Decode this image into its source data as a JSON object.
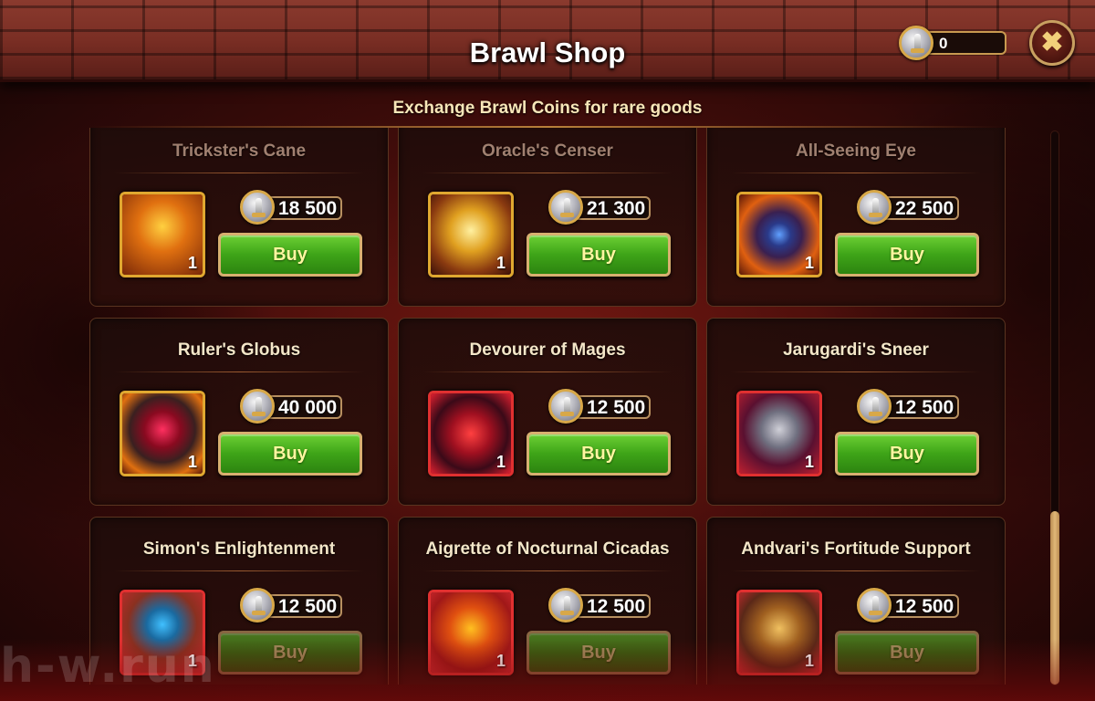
{
  "header": {
    "title": "Brawl Shop",
    "subtitle": "Exchange Brawl Coins for rare goods",
    "coin_balance": "0",
    "close_icon": "close-icon",
    "coin_icon": "brawl-coin-icon"
  },
  "items": [
    {
      "name": "Trickster's Cane",
      "price": "18 500",
      "qty": "1",
      "buy_label": "Buy",
      "frame": "gold",
      "icon": "trickster-cane-icon"
    },
    {
      "name": "Oracle's Censer",
      "price": "21 300",
      "qty": "1",
      "buy_label": "Buy",
      "frame": "gold",
      "icon": "oracle-censer-icon"
    },
    {
      "name": "All-Seeing Eye",
      "price": "22 500",
      "qty": "1",
      "buy_label": "Buy",
      "frame": "gold",
      "icon": "all-seeing-eye-icon"
    },
    {
      "name": "Ruler's Globus",
      "price": "40 000",
      "qty": "1",
      "buy_label": "Buy",
      "frame": "gold",
      "icon": "rulers-globus-icon"
    },
    {
      "name": "Devourer of Mages",
      "price": "12 500",
      "qty": "1",
      "buy_label": "Buy",
      "frame": "red",
      "icon": "devourer-of-mages-icon"
    },
    {
      "name": "Jarugardi's Sneer",
      "price": "12 500",
      "qty": "1",
      "buy_label": "Buy",
      "frame": "red",
      "icon": "jarugardi-sneer-icon"
    },
    {
      "name": "Simon's Enlightenment",
      "price": "12 500",
      "qty": "1",
      "buy_label": "Buy",
      "frame": "red",
      "icon": "simons-enlightenment-icon"
    },
    {
      "name": "Aigrette of Nocturnal Cicadas",
      "price": "12 500",
      "qty": "1",
      "buy_label": "Buy",
      "frame": "red",
      "icon": "aigrette-icon"
    },
    {
      "name": "Andvari's Fortitude Support",
      "price": "12 500",
      "qty": "1",
      "buy_label": "Buy",
      "frame": "red",
      "icon": "andvari-fortitude-icon"
    }
  ],
  "watermark": "h-w.run",
  "colors": {
    "buy_green": "#3ea418",
    "gold_frame": "#e0a830",
    "red_frame": "#e03030",
    "accent_gold": "#c89a50"
  }
}
